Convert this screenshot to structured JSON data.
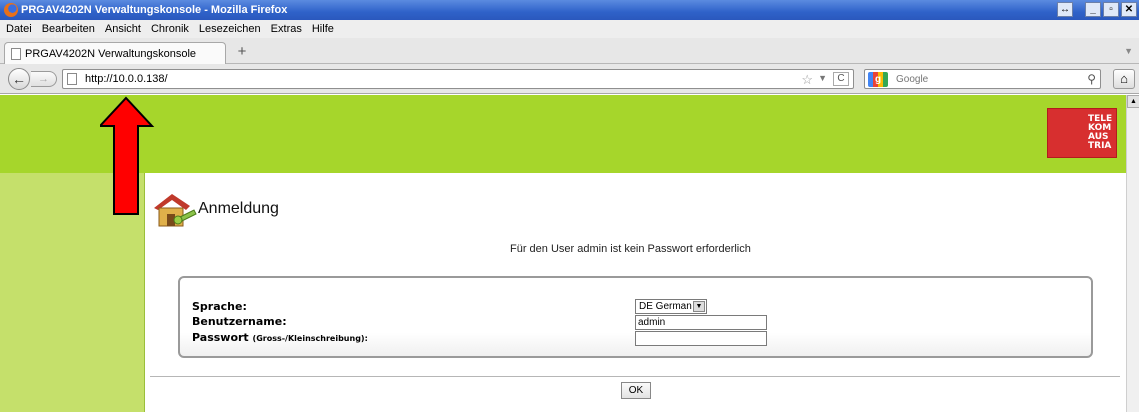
{
  "window": {
    "title": "PRGAV4202N Verwaltungskonsole - Mozilla Firefox",
    "controls": [
      "↔",
      "_",
      "▫",
      "✕"
    ]
  },
  "menu": [
    "Datei",
    "Bearbeiten",
    "Ansicht",
    "Chronik",
    "Lesezeichen",
    "Extras",
    "Hilfe"
  ],
  "tab": {
    "title": "PRGAV4202N Verwaltungskonsole",
    "new_tab": "+"
  },
  "nav": {
    "url": "http://10.0.0.138/",
    "search_placeholder": "Google",
    "g_letter": "g"
  },
  "page": {
    "logo_text": "TELE\nKOM\nAUS\nTRIA",
    "heading": "Anmeldung",
    "notice": "Für den User admin ist kein Passwort erforderlich",
    "labels": {
      "language": "Sprache:",
      "username": "Benutzername:",
      "password": "Passwort",
      "password_hint": "(Gross-/Kleinschreibung):"
    },
    "language_value": "DE German",
    "username_value": "admin",
    "password_value": "",
    "ok_label": "OK"
  },
  "colors": {
    "header_green": "#a6d62b",
    "sidebar_green": "#c5e06b",
    "logo_red": "#d72f2f",
    "annotation_red": "#ff0000"
  }
}
